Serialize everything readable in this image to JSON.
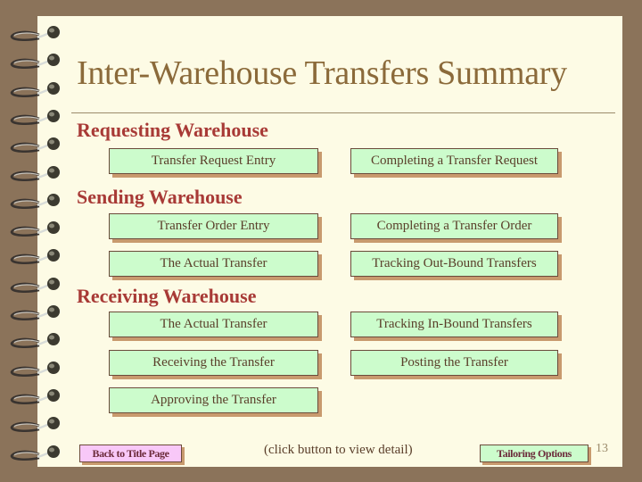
{
  "slide": {
    "title": "Inter-Warehouse Transfers Summary",
    "page_number": "13"
  },
  "sections": [
    {
      "heading": "Requesting Warehouse",
      "buttons": [
        {
          "label": "Transfer Request Entry"
        },
        {
          "label": "Completing a Transfer Request"
        }
      ]
    },
    {
      "heading": "Sending Warehouse",
      "buttons": [
        {
          "label": "Transfer Order Entry"
        },
        {
          "label": "Completing a Transfer Order"
        },
        {
          "label": "The Actual Transfer"
        },
        {
          "label": "Tracking Out-Bound Transfers"
        }
      ]
    },
    {
      "heading": "Receiving Warehouse",
      "buttons": [
        {
          "label": "The Actual Transfer"
        },
        {
          "label": "Tracking In-Bound Transfers"
        },
        {
          "label": "Receiving the Transfer"
        },
        {
          "label": "Posting the Transfer"
        },
        {
          "label": "Approving the Transfer"
        }
      ]
    }
  ],
  "footer": {
    "back_label": "Back to Title Page",
    "hint": "(click button to view detail)",
    "tailoring_label": "Tailoring Options"
  },
  "colors": {
    "background": "#8b735a",
    "page": "#fdfbe5",
    "title": "#8b6a3a",
    "heading": "#a83a36",
    "button_fill": "#ccfccc",
    "button_shadow": "#c89a6e",
    "back_button_fill": "#f8c8f8"
  }
}
